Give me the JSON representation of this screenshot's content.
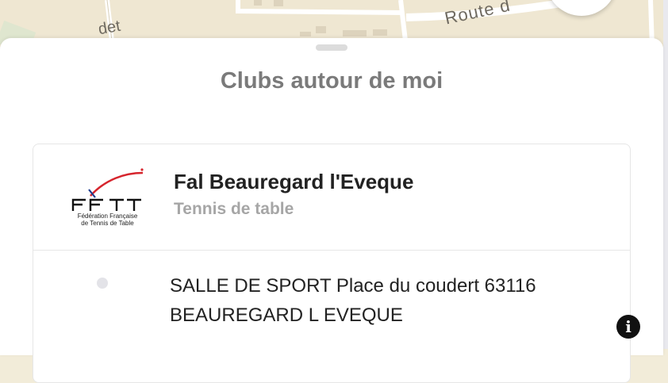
{
  "map": {
    "road_label_1": "Route d",
    "road_label_2": "det"
  },
  "sheet": {
    "title": "Clubs autour de moi"
  },
  "club": {
    "name": "Fal Beauregard l'Eveque",
    "sport": "Tennis de table",
    "logo": {
      "letters": "FFTT",
      "subtitle_line1": "Fédération Française",
      "subtitle_line2": "de Tennis de Table"
    },
    "address_line1": "SALLE DE SPORT Place du coudert 63116",
    "address_line2": "BEAUREGARD L EVEQUE"
  },
  "colors": {
    "map_bg": "#efe7d2",
    "title": "#7a7a7a",
    "sport": "#a6a6a6",
    "logo_red": "#d6252d",
    "logo_blue": "#1f3c8f"
  },
  "icons": {
    "info": "info-circle-icon",
    "address": "location-dot-icon"
  }
}
